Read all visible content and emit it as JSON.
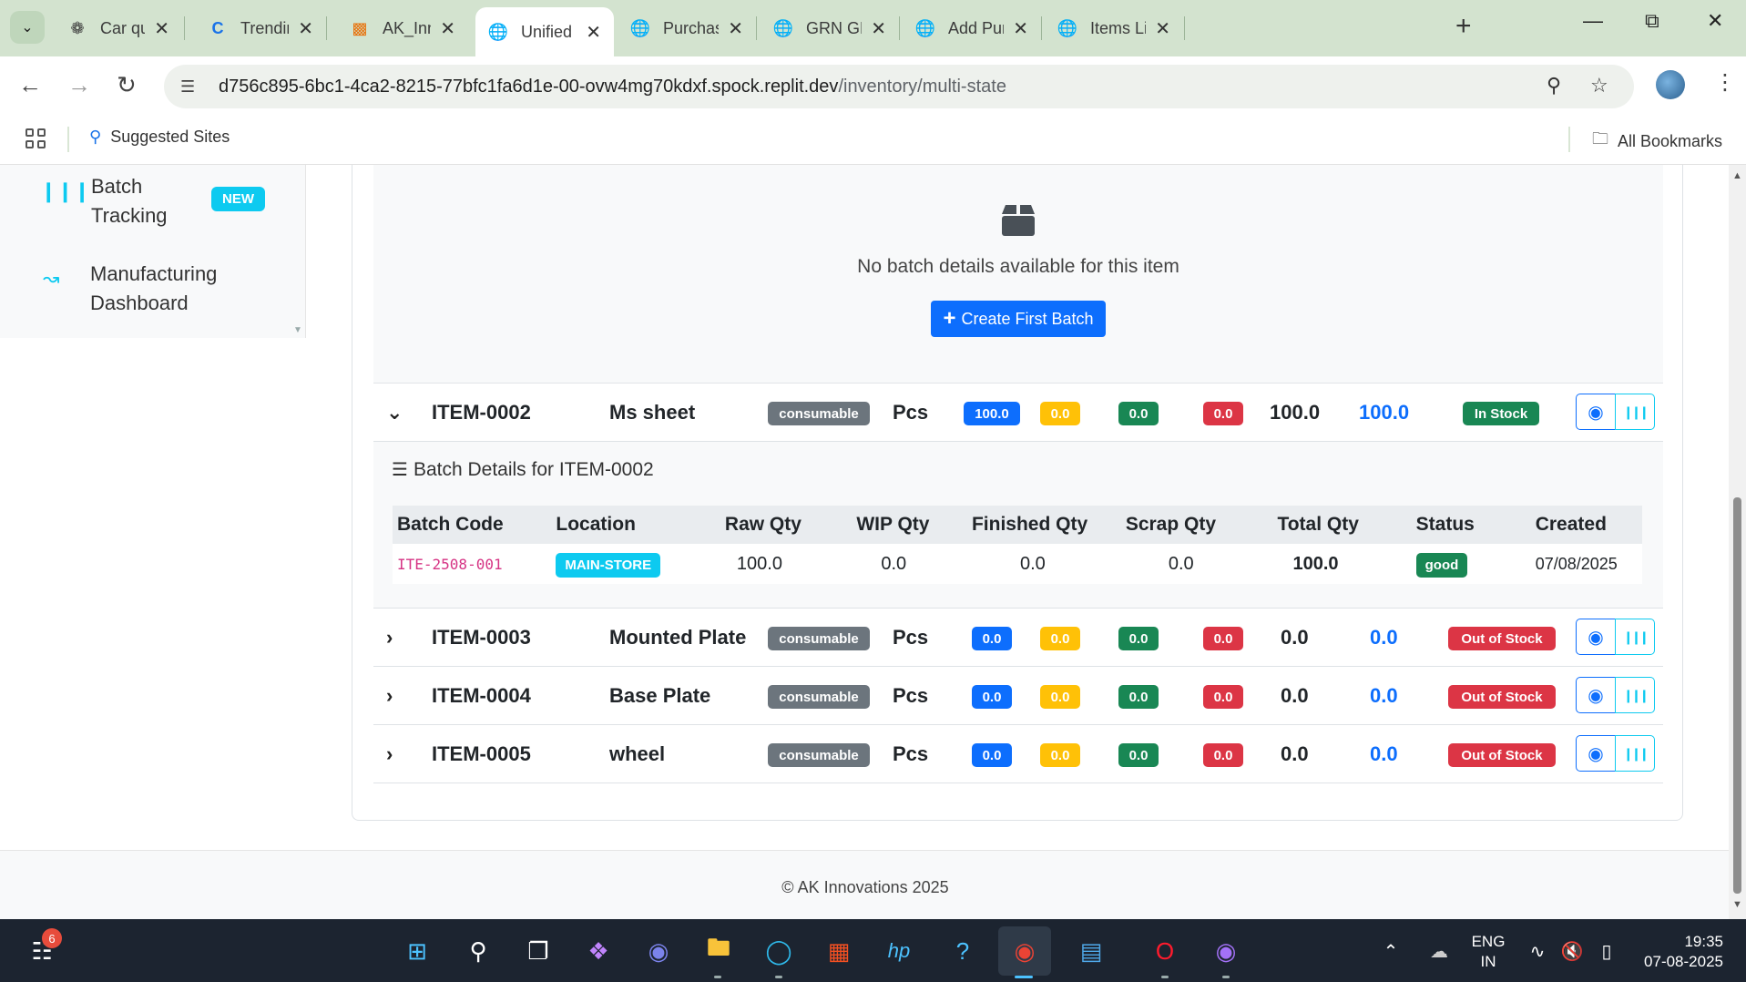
{
  "browser": {
    "tabs": [
      {
        "title": "Car quotat",
        "icon": "openai-icon"
      },
      {
        "title": "Trending C",
        "icon": "c-logo-icon"
      },
      {
        "title": "AK_Innova",
        "icon": "diagram-icon"
      },
      {
        "title": "Unified Mu",
        "icon": "globe-icon",
        "active": true
      },
      {
        "title": "Purchase D",
        "icon": "globe-icon"
      },
      {
        "title": "GRN GRN-",
        "icon": "globe-icon"
      },
      {
        "title": "Add Purch",
        "icon": "globe-icon"
      },
      {
        "title": "Items List",
        "icon": "globe-icon"
      }
    ],
    "url_host": "d756c895-6bc1-4ca2-8215-77bfc1fa6d1e-00-ovw4mg70kdxf.spock.replit.dev",
    "url_path": "/inventory/multi-state",
    "bookmarks": {
      "suggested": "Suggested Sites",
      "all": "All Bookmarks"
    }
  },
  "sidebar": {
    "items": [
      {
        "label": "Batch Tracking",
        "badge": "NEW",
        "icon": "barcode-icon"
      },
      {
        "label": "Manufacturing Dashboard",
        "icon": "chart-line-icon"
      }
    ]
  },
  "empty_batch": {
    "text": "No batch details available for this item",
    "button": "Create First Batch"
  },
  "item_0002": {
    "code": "ITEM-0002",
    "name": "Ms sheet",
    "type": "consumable",
    "unit": "Pcs",
    "raw": "100.0",
    "wip": "0.0",
    "finished": "0.0",
    "scrap": "0.0",
    "total": "100.0",
    "available": "100.0",
    "status": "In Stock"
  },
  "batch_details": {
    "title": "Batch Details for ITEM-0002",
    "headers": {
      "code": "Batch Code",
      "location": "Location",
      "raw": "Raw Qty",
      "wip": "WIP Qty",
      "finished": "Finished Qty",
      "scrap": "Scrap Qty",
      "total": "Total Qty",
      "status": "Status",
      "created": "Created"
    },
    "row": {
      "code": "ITE-2508-001",
      "location": "MAIN-STORE",
      "raw": "100.0",
      "wip": "0.0",
      "finished": "0.0",
      "scrap": "0.0",
      "total": "100.0",
      "status": "good",
      "created": "07/08/2025"
    }
  },
  "items": [
    {
      "code": "ITEM-0003",
      "name": "Mounted Plate",
      "type": "consumable",
      "unit": "Pcs",
      "raw": "0.0",
      "wip": "0.0",
      "finished": "0.0",
      "scrap": "0.0",
      "total": "0.0",
      "available": "0.0",
      "status": "Out of Stock"
    },
    {
      "code": "ITEM-0004",
      "name": "Base Plate",
      "type": "consumable",
      "unit": "Pcs",
      "raw": "0.0",
      "wip": "0.0",
      "finished": "0.0",
      "scrap": "0.0",
      "total": "0.0",
      "available": "0.0",
      "status": "Out of Stock"
    },
    {
      "code": "ITEM-0005",
      "name": "wheel",
      "type": "consumable",
      "unit": "Pcs",
      "raw": "0.0",
      "wip": "0.0",
      "finished": "0.0",
      "scrap": "0.0",
      "total": "0.0",
      "available": "0.0",
      "status": "Out of Stock"
    }
  ],
  "footer": "© AK Innovations 2025",
  "taskbar": {
    "notif_count": "6",
    "lang": "ENG",
    "region": "IN",
    "time": "19:35",
    "date": "07-08-2025"
  },
  "colors": {
    "primary": "#0d6efd",
    "info": "#0dcaf0",
    "success": "#198754",
    "warning": "#ffc107",
    "danger": "#dc3545",
    "secondary": "#6c757d"
  }
}
